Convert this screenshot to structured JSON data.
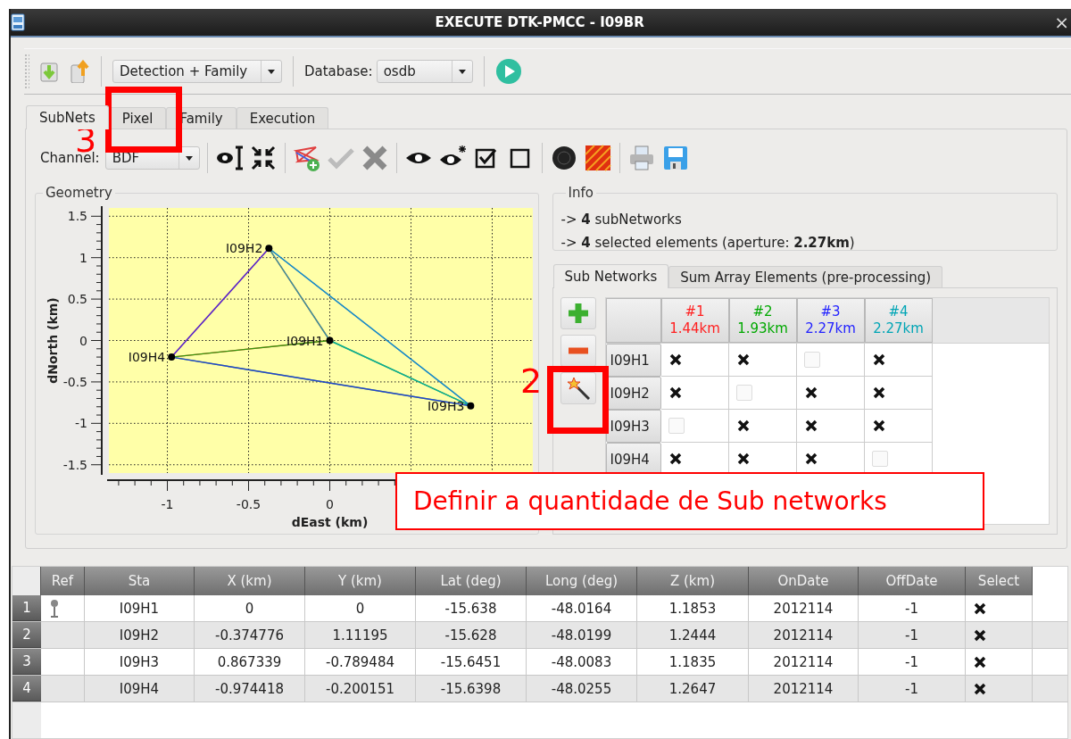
{
  "window": {
    "title": "EXECUTE DTK-PMCC - I09BR",
    "close": "×"
  },
  "toolbar": {
    "mode": "Detection + Family",
    "database_label": "Database:",
    "database": "osdb"
  },
  "tabs": [
    {
      "label": "SubNets",
      "selected": true
    },
    {
      "label": "Pixel",
      "selected": false
    },
    {
      "label": "Family",
      "selected": false
    },
    {
      "label": "Execution",
      "selected": false
    }
  ],
  "channel": {
    "label": "Channel:",
    "value": "BDF"
  },
  "geometry": {
    "title": "Geometry",
    "chart_data": {
      "type": "scatter",
      "xlabel": "dEast (km)",
      "ylabel": "dNorth (km)",
      "x": [
        0,
        -0.374776,
        0.867339,
        -0.974418
      ],
      "series": [
        {
          "color": "#000000",
          "values": [
            0,
            1.11195,
            -0.789484,
            -0.200151
          ]
        }
      ],
      "grid": true,
      "xlim": [
        -1.36,
        1.25
      ],
      "ylim": [
        -1.6,
        1.6
      ],
      "xticks": [
        -1,
        -0.5,
        0
      ],
      "yticks": [
        -1.5,
        -1,
        -0.5,
        0,
        0.5,
        1,
        1.5
      ],
      "annotations": [
        {
          "x": 0,
          "y": 0,
          "text": "I09H1"
        },
        {
          "x": -0.374776,
          "y": 1.11195,
          "text": "I09H2"
        },
        {
          "x": 0.867339,
          "y": -0.789484,
          "text": "I09H3"
        },
        {
          "x": -0.974418,
          "y": -0.200151,
          "text": "I09H4"
        }
      ]
    }
  },
  "info": {
    "title": "Info",
    "lines": [
      "-> **4** subNetworks",
      "-> **4** selected elements (aperture: **2.27km**)"
    ]
  },
  "subtabs": [
    {
      "label": "Sub Networks",
      "selected": true
    },
    {
      "label": "Sum Array Elements (pre-processing)",
      "selected": false
    }
  ],
  "subnetworks": {
    "columns": [
      {
        "label": "#1",
        "aperture": "1.44km",
        "color": "#ff2020"
      },
      {
        "label": "#2",
        "aperture": "1.93km",
        "color": "#00a800"
      },
      {
        "label": "#3",
        "aperture": "2.27km",
        "color": "#2222ff"
      },
      {
        "label": "#4",
        "aperture": "2.27km",
        "color": "#00a5b5"
      }
    ],
    "rows": [
      {
        "station": "I09H1",
        "checked": [
          true,
          true,
          false,
          true
        ]
      },
      {
        "station": "I09H2",
        "checked": [
          true,
          false,
          true,
          true
        ]
      },
      {
        "station": "I09H3",
        "checked": [
          false,
          true,
          true,
          true
        ]
      },
      {
        "station": "I09H4",
        "checked": [
          true,
          true,
          true,
          false
        ]
      }
    ]
  },
  "stations": {
    "columns": [
      "Ref",
      "Sta",
      "X (km)",
      "Y (km)",
      "Lat (deg)",
      "Long (deg)",
      "Z (km)",
      "OnDate",
      "OffDate",
      "Select"
    ],
    "rows": [
      {
        "number": "1",
        "ref": true,
        "cells": [
          "",
          "I09H1",
          "0",
          "0",
          "-15.638",
          "-48.0164",
          "1.1853",
          "2012114",
          "-1"
        ],
        "selected": true
      },
      {
        "number": "2",
        "ref": false,
        "cells": [
          "",
          "I09H2",
          "-0.374776",
          "1.11195",
          "-15.628",
          "-48.0199",
          "1.2444",
          "2012114",
          "-1"
        ],
        "selected": true
      },
      {
        "number": "3",
        "ref": false,
        "cells": [
          "",
          "I09H3",
          "0.867339",
          "-0.789484",
          "-15.6451",
          "-48.0083",
          "1.1835",
          "2012114",
          "-1"
        ],
        "selected": true
      },
      {
        "number": "4",
        "ref": false,
        "cells": [
          "",
          "I09H4",
          "-0.974418",
          "-0.200151",
          "-15.6398",
          "-48.0255",
          "1.2647",
          "2012114",
          "-1"
        ],
        "selected": true
      }
    ]
  },
  "annotations": [
    {
      "kind": "marker",
      "label": "3"
    },
    {
      "kind": "marker",
      "label": "2"
    },
    {
      "kind": "callout",
      "text": "Definir a quantidade de Sub networks"
    }
  ]
}
